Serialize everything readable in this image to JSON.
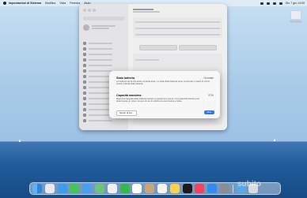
{
  "menubar": {
    "app_name": "Impostazioni di Sistema",
    "menus": [
      "Modifica",
      "Vista",
      "Finestra",
      "Aiuto"
    ],
    "clock": "Gio 7 giu 14:00"
  },
  "desktop": {
    "icon_label": "Screenshot"
  },
  "dialog": {
    "section1_title": "Stato batteria",
    "section1_value": "Normale",
    "section1_desc": "La batteria sta funzionando correttamente. Lo stato della batteria viene monitorato in base ai cicli di carica e all'età della batteria.",
    "section2_title": "Capacità massima",
    "section2_value": "97%",
    "section2_desc": "Misura la capacità della batteria rispetto a quando era nuova. Una capacità inferiore può determinare un minor numero di ore di utilizzo tra una ricarica e l'altra.",
    "help_button": "Scopri di più...",
    "ok_button": "Fine"
  },
  "watermark": "subito"
}
